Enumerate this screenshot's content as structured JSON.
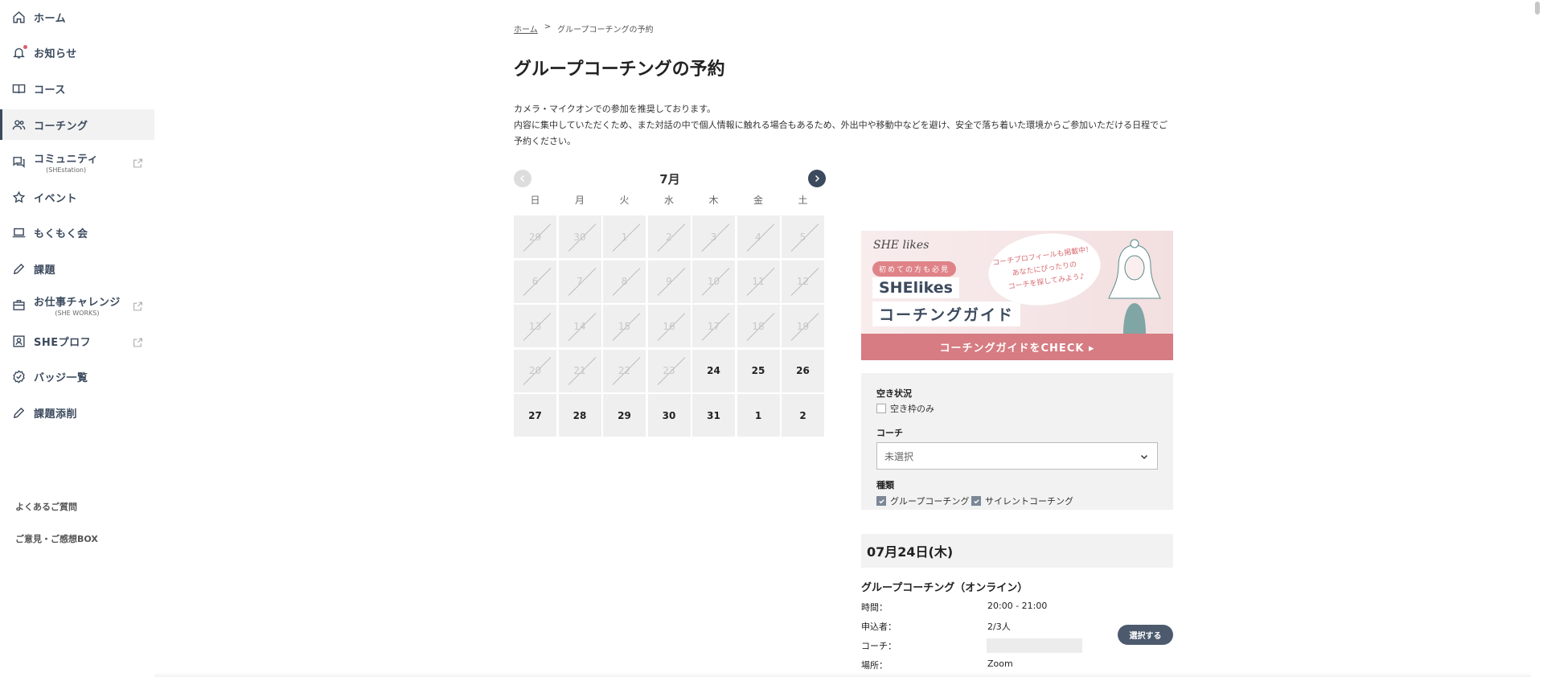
{
  "sidebar": {
    "items": [
      {
        "label": "ホーム",
        "icon": "home-icon"
      },
      {
        "label": "お知らせ",
        "icon": "bell-icon"
      },
      {
        "label": "コース",
        "icon": "book-icon"
      },
      {
        "label": "コーチング",
        "icon": "people-icon"
      },
      {
        "label": "コミュニティ",
        "sub": "(SHEstation)",
        "icon": "chat-icon"
      },
      {
        "label": "イベント",
        "icon": "star-icon"
      },
      {
        "label": "もくもく会",
        "icon": "laptop-icon"
      },
      {
        "label": "課題",
        "icon": "pencil-icon"
      },
      {
        "label": "お仕事チャレンジ",
        "sub": "(SHE WORKS)",
        "icon": "briefcase-icon"
      },
      {
        "label": "SHEプロフ",
        "icon": "profile-icon"
      },
      {
        "label": "バッジ一覧",
        "icon": "badge-icon"
      },
      {
        "label": "課題添削",
        "icon": "pencil-icon"
      }
    ],
    "active_index": 3,
    "footer": [
      "よくあるご質問",
      "ご意見・ご感想BOX"
    ]
  },
  "breadcrumb": {
    "home": "ホーム",
    "separator": ">",
    "current": "グループコーチングの予約"
  },
  "page_title": "グループコーチングの予約",
  "intro": {
    "line1": "カメラ・マイクオンでの参加を推奨しております。",
    "line2": "内容に集中していただくため、また対話の中で個人情報に触れる場合もあるため、外出中や移動中などを避け、安全で落ち着いた環境からご参加いただける日程でご予約ください。"
  },
  "calendar": {
    "month": "7月",
    "weekdays": [
      "日",
      "月",
      "火",
      "水",
      "木",
      "金",
      "土"
    ],
    "days": [
      {
        "d": "29",
        "s": "disabled"
      },
      {
        "d": "30",
        "s": "disabled"
      },
      {
        "d": "1",
        "s": "disabled"
      },
      {
        "d": "2",
        "s": "disabled"
      },
      {
        "d": "3",
        "s": "disabled"
      },
      {
        "d": "4",
        "s": "disabled"
      },
      {
        "d": "5",
        "s": "disabled"
      },
      {
        "d": "6",
        "s": "disabled"
      },
      {
        "d": "7",
        "s": "disabled"
      },
      {
        "d": "8",
        "s": "disabled"
      },
      {
        "d": "9",
        "s": "disabled"
      },
      {
        "d": "10",
        "s": "disabled"
      },
      {
        "d": "11",
        "s": "disabled"
      },
      {
        "d": "12",
        "s": "disabled"
      },
      {
        "d": "13",
        "s": "disabled"
      },
      {
        "d": "14",
        "s": "disabled"
      },
      {
        "d": "15",
        "s": "disabled"
      },
      {
        "d": "16",
        "s": "disabled"
      },
      {
        "d": "17",
        "s": "disabled"
      },
      {
        "d": "18",
        "s": "disabled"
      },
      {
        "d": "19",
        "s": "disabled"
      },
      {
        "d": "20",
        "s": "disabled"
      },
      {
        "d": "21",
        "s": "disabled"
      },
      {
        "d": "22",
        "s": "disabled"
      },
      {
        "d": "23",
        "s": "disabled"
      },
      {
        "d": "24",
        "s": "available"
      },
      {
        "d": "25",
        "s": "available"
      },
      {
        "d": "26",
        "s": "available"
      },
      {
        "d": "27",
        "s": "available"
      },
      {
        "d": "28",
        "s": "available"
      },
      {
        "d": "29",
        "s": "available"
      },
      {
        "d": "30",
        "s": "available"
      },
      {
        "d": "31",
        "s": "available"
      },
      {
        "d": "1",
        "s": "available"
      },
      {
        "d": "2",
        "s": "available"
      }
    ]
  },
  "banner": {
    "logo": "SHE likes",
    "pill": "初めての方も必見",
    "brand": "SHElikes",
    "title": "コーチングガイド",
    "bubble_line1": "コーチプロフィールも掲載中！",
    "bubble_line2": "あなたにぴったりの",
    "bubble_line3": "コーチを探してみよう♪",
    "cta": "コーチングガイドをCHECK ▸"
  },
  "filter": {
    "availability_label": "空き状況",
    "availability_option": "空き枠のみ",
    "coach_label": "コーチ",
    "coach_placeholder": "未選択",
    "type_label": "種類",
    "type_group": "グループコーチング",
    "type_silent": "サイレントコーチング"
  },
  "selected_date": "07月24日(木)",
  "session": {
    "title": "グループコーチング（オンライン）",
    "time_label": "時間：",
    "time_value": "20:00 - 21:00",
    "applicants_label": "申込者：",
    "applicants_value": "2/3人",
    "coach_label": "コーチ：",
    "place_label": "場所：",
    "place_value": "Zoom",
    "select_button": "選択する"
  },
  "colors": {
    "accent": "#3c4a5e",
    "banner_pink": "#d67c82",
    "panel_bg": "#f2f2f2"
  }
}
